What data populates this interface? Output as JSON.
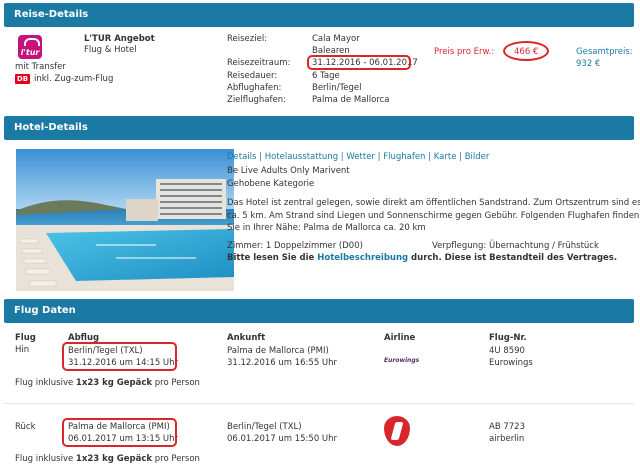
{
  "reise": {
    "header": "Reise-Details",
    "provider": "L'TUR Angebot",
    "type": "Flug & Hotel",
    "transfer": "mit Transfer",
    "train": "inkl. Zug-zum-Flug",
    "logo_text": "l'tur",
    "db_text": "DB",
    "labels": {
      "reiseziel": "Reiseziel:",
      "reisezeitraum": "Reisezeitraum:",
      "reisedauer": "Reisedauer:",
      "abflughafen": "Abflughafen:",
      "zielflughafen": "Zielflughafen:"
    },
    "values": {
      "reiseziel_1": "Cala Mayor",
      "reiseziel_2": "Balearen",
      "reisezeitraum": "31.12.2016 - 06.01.2017",
      "reisedauer": "6 Tage",
      "abflughafen": "Berlin/Tegel",
      "zielflughafen": "Palma de Mallorca"
    },
    "preis_label": "Preis pro Erw.:",
    "preis_value": "466 €",
    "gesamt_label": "Gesamtpreis:",
    "gesamt_value": "932 €"
  },
  "hotel": {
    "header": "Hotel-Details",
    "links": [
      "Details",
      "Hotelausstattung",
      "Wetter",
      "Flughafen",
      "Karte",
      "Bilder"
    ],
    "name": "Be Live Adults Only Marivent",
    "category": "Gehobene Kategorie",
    "description_1": "Das Hotel ist zentral gelegen, sowie direkt am öffentlichen Sandstrand. Zum Ortszentrum sind es",
    "description_2": "ca. 5 km. Am Strand sind Liegen und Sonnenschirme gegen Gebühr. Folgenden Flughafen finden",
    "description_3": "Sie in Ihrer Nähe: Palma de Mallorca ca. 20 km",
    "zimmer": "Zimmer: 1 Doppelzimmer (D00)",
    "verpflegung": "Verpflegung: Übernachtung / Frühstück",
    "notice_pre": "Bitte lesen Sie die ",
    "notice_link": "Hotelbeschreibung",
    "notice_post": " durch. Diese ist Bestandteil des Vertrages."
  },
  "flug": {
    "header": "Flug Daten",
    "columns": {
      "flug": "Flug",
      "abflug": "Abflug",
      "ankunft": "Ankunft",
      "airline": "Airline",
      "flugnr": "Flug-Nr."
    },
    "hin": {
      "label": "Hin",
      "abflug_ort": "Berlin/Tegel (TXL)",
      "abflug_zeit": "31.12.2016 um 14:15 Uhr",
      "ankunft_ort": "Palma de Mallorca (PMI)",
      "ankunft_zeit": "31.12.2016 um 16:55 Uhr",
      "airline_logo": "Eurowings",
      "flugnr": "4U 8590",
      "airline": "Eurowings"
    },
    "rueck": {
      "label": "Rück",
      "abflug_ort": "Palma de Mallorca (PMI)",
      "abflug_zeit": "06.01.2017 um 13:15 Uhr",
      "ankunft_ort": "Berlin/Tegel (TXL)",
      "ankunft_zeit": "06.01.2017 um 15:50 Uhr",
      "flugnr": "AB 7723",
      "airline": "airberlin"
    },
    "gepaeck_pre": "Flug inklusive ",
    "gepaeck_bold": "1x23 kg Gepäck",
    "gepaeck_post": " pro Person"
  }
}
